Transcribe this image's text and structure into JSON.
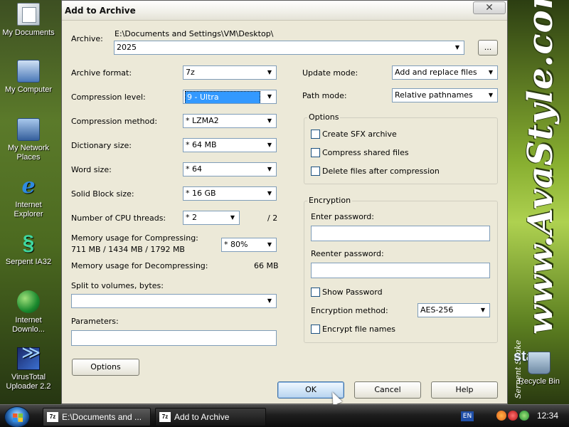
{
  "desktop": {
    "icons": [
      {
        "label": "My Documents"
      },
      {
        "label": "My Computer"
      },
      {
        "label": "My Network Places"
      },
      {
        "label": "Internet Explorer"
      },
      {
        "label": "Serpent IA32"
      },
      {
        "label": "Internet Downlo..."
      },
      {
        "label": "VirusTotal Uploader 2.2"
      },
      {
        "label": "Recycle Bin"
      }
    ],
    "watermark": "www.AvaStyle.com",
    "watermark_sub": "Serpent Shake",
    "vista_text": "sta"
  },
  "dialog": {
    "title": "Add to Archive",
    "close_symbol": "✕",
    "archive_label": "Archive:",
    "archive_path": "E:\\Documents and Settings\\VM\\Desktop\\",
    "archive_name": "2025",
    "browse_label": "...",
    "archive_format_label": "Archive format:",
    "archive_format": "7z",
    "compression_level_label": "Compression level:",
    "compression_level": "9 - Ultra",
    "compression_method_label": "Compression method:",
    "compression_method": "* LZMA2",
    "dictionary_size_label": "Dictionary size:",
    "dictionary_size": "* 64 MB",
    "word_size_label": "Word size:",
    "word_size": "* 64",
    "solid_block_label": "Solid Block size:",
    "solid_block": "* 16 GB",
    "cpu_threads_label": "Number of CPU threads:",
    "cpu_threads": "* 2",
    "cpu_threads_max": "/ 2",
    "mem_compress_label": "Memory usage for Compressing:",
    "mem_compress_values": "711 MB / 1434 MB / 1792 MB",
    "mem_compress_percent": "* 80%",
    "mem_decompress_label": "Memory usage for Decompressing:",
    "mem_decompress_value": "66 MB",
    "split_label": "Split to volumes, bytes:",
    "split_value": "",
    "parameters_label": "Parameters:",
    "parameters_value": "",
    "options_button": "Options",
    "update_mode_label": "Update mode:",
    "update_mode": "Add and replace files",
    "path_mode_label": "Path mode:",
    "path_mode": "Relative pathnames",
    "options_group": {
      "title": "Options",
      "create_sfx": "Create SFX archive",
      "compress_shared": "Compress shared files",
      "delete_after": "Delete files after compression"
    },
    "encryption_group": {
      "title": "Encryption",
      "enter_password": "Enter password:",
      "reenter_password": "Reenter password:",
      "show_password": "Show Password",
      "method_label": "Encryption method:",
      "method": "AES-256",
      "encrypt_names": "Encrypt file names"
    },
    "ok_button": "OK",
    "cancel_button": "Cancel",
    "help_button": "Help",
    "dropdown_arrow": "▼"
  },
  "taskbar": {
    "task1": "E:\\Documents and ...",
    "task2": "Add to Archive",
    "task_icon": "7z",
    "language": "EN",
    "clock": "12:34"
  }
}
